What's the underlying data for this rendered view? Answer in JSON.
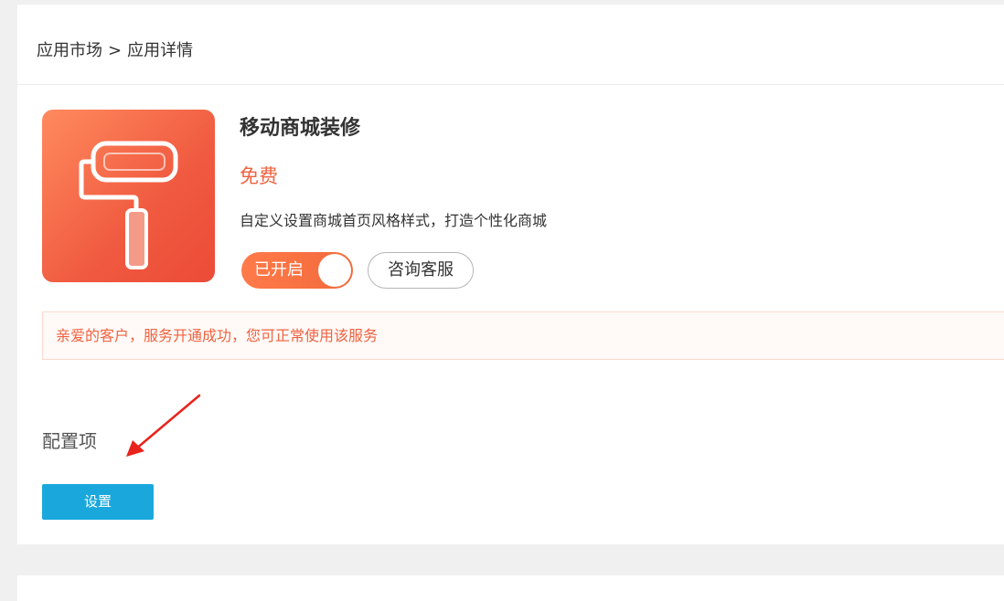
{
  "breadcrumb": {
    "root": "应用市场",
    "separator": ">",
    "current": "应用详情"
  },
  "app": {
    "icon": "paint-roller-icon",
    "title": "移动商城装修",
    "price": "免费",
    "description": "自定义设置商城首页风格样式，打造个性化商城",
    "toggle_label": "已开启",
    "toggle_on": true,
    "consult_label": "咨询客服"
  },
  "notice": {
    "text": "亲爱的客户，服务开通成功，您可正常使用该服务"
  },
  "config": {
    "label": "配置项",
    "settings_button": "设置"
  },
  "colors": {
    "accent_orange": "#f0623f",
    "primary_blue": "#1aa8dc",
    "annotation_red": "#e8231b"
  }
}
